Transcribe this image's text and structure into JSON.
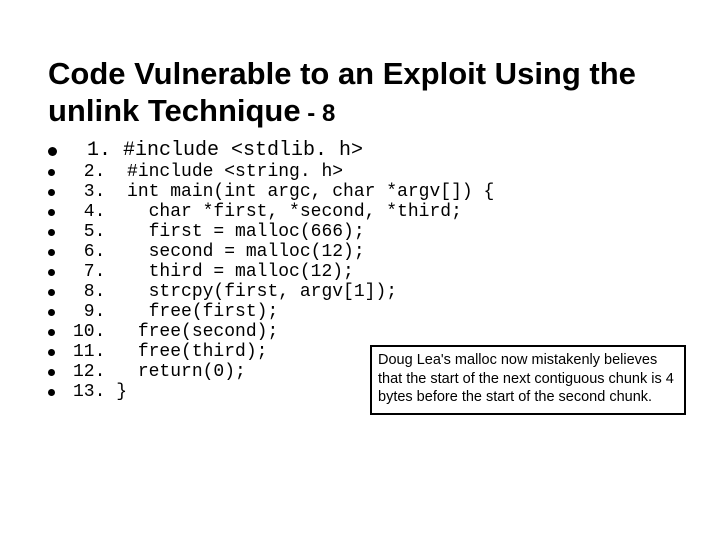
{
  "title_main": "Code Vulnerable to an Exploit Using the unlink Technique",
  "title_suffix": " - 8",
  "code_lines": [
    {
      "num": " 1. ",
      "text": "#include <stdlib. h>"
    },
    {
      "num": " 2. ",
      "text": " #include <string. h>"
    },
    {
      "num": " 3. ",
      "text": " int main(int argc, char *argv[]) {"
    },
    {
      "num": " 4. ",
      "text": "   char *first, *second, *third;"
    },
    {
      "num": " 5. ",
      "text": "   first = malloc(666);"
    },
    {
      "num": " 6. ",
      "text": "   second = malloc(12);"
    },
    {
      "num": " 7. ",
      "text": "   third = malloc(12);"
    },
    {
      "num": " 8. ",
      "text": "   strcpy(first, argv[1]);"
    },
    {
      "num": " 9. ",
      "text": "   free(first);"
    },
    {
      "num": "10. ",
      "text": "  free(second);"
    },
    {
      "num": "11. ",
      "text": "  free(third);"
    },
    {
      "num": "12. ",
      "text": "  return(0);"
    },
    {
      "num": "13. ",
      "text": "}"
    }
  ],
  "callout_text": "Doug Lea's malloc now mistakenly believes that the start of the next contiguous chunk is 4 bytes before the start of the second chunk."
}
